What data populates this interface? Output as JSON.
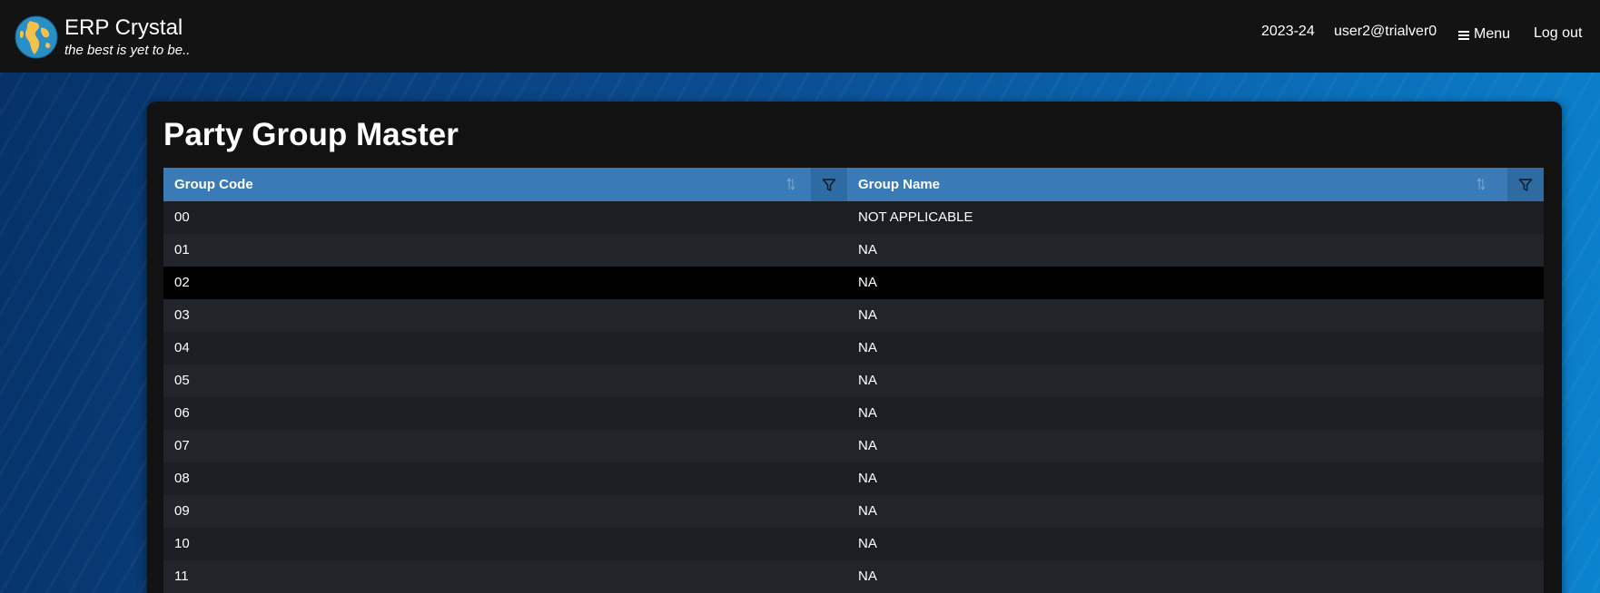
{
  "navbar": {
    "brand_title": "ERP Crystal",
    "brand_tagline": "the best is yet to be..",
    "year": "2023-24",
    "user": "user2@trialver0",
    "menu_label": "Menu",
    "logout_label": "Log out",
    "icons": {
      "logo": "globe-logo-icon",
      "menu": "hamburger-icon"
    }
  },
  "page": {
    "title": "Party Group Master"
  },
  "grid": {
    "columns": [
      {
        "label": "Group Code",
        "sort_icon": "sort-icon",
        "filter_icon": "filter-icon"
      },
      {
        "label": "Group Name",
        "sort_icon": "sort-icon",
        "filter_icon": "filter-icon"
      }
    ],
    "rows": [
      {
        "code": "00",
        "name": "NOT APPLICABLE"
      },
      {
        "code": "01",
        "name": "NA"
      },
      {
        "code": "02",
        "name": "NA"
      },
      {
        "code": "03",
        "name": "NA"
      },
      {
        "code": "04",
        "name": "NA"
      },
      {
        "code": "05",
        "name": "NA"
      },
      {
        "code": "06",
        "name": "NA"
      },
      {
        "code": "07",
        "name": "NA"
      },
      {
        "code": "08",
        "name": "NA"
      },
      {
        "code": "09",
        "name": "NA"
      },
      {
        "code": "10",
        "name": "NA"
      },
      {
        "code": "11",
        "name": "NA"
      }
    ],
    "selected_row_code": "02"
  },
  "colors": {
    "navbar_bg": "#131313",
    "header_bg": "#3a7ab6",
    "card_bg": "#121212",
    "row_even": "#1b1e22",
    "row_odd": "#212429",
    "row_selected": "#000000"
  }
}
